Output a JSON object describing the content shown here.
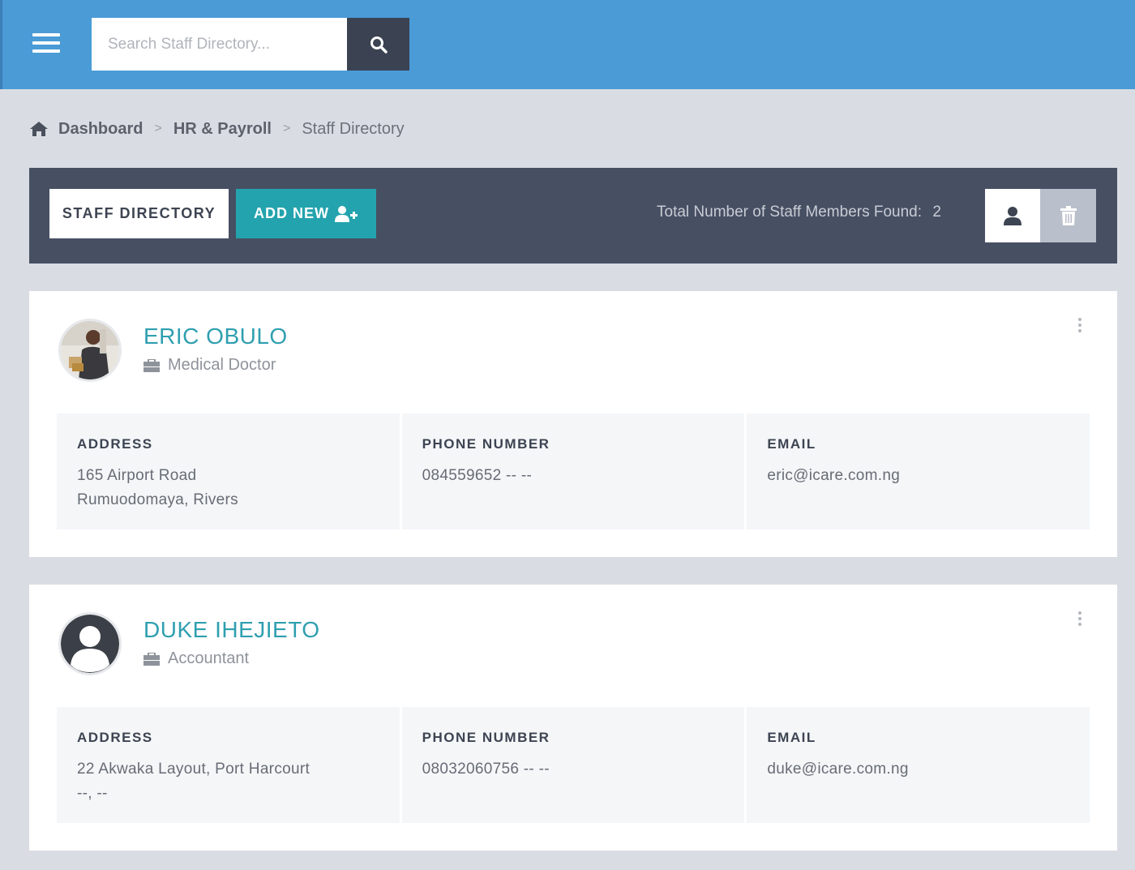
{
  "search": {
    "placeholder": "Search Staff Directory..."
  },
  "breadcrumb": {
    "items": [
      "Dashboard",
      "HR & Payroll",
      "Staff Directory"
    ]
  },
  "toolbar": {
    "directory_label": "STAFF DIRECTORY",
    "add_new_label": "ADD NEW",
    "total_label": "Total Number of Staff Members Found:",
    "total_count": "2"
  },
  "colors": {
    "topbar": "#4a9bd6",
    "toolbar": "#474f63",
    "accent": "#23a3ad",
    "name": "#2f9fb0"
  },
  "staff": [
    {
      "name": "ERIC OBULO",
      "role": "Medical Doctor",
      "avatar": "photo",
      "address_label": "ADDRESS",
      "address_line1": "165 Airport Road",
      "address_line2": "Rumuodomaya, Rivers",
      "phone_label": "PHONE NUMBER",
      "phone": "084559652 -- --",
      "email_label": "EMAIL",
      "email": "eric@icare.com.ng"
    },
    {
      "name": "DUKE IHEJIETO",
      "role": "Accountant",
      "avatar": "default-user-icon",
      "address_label": "ADDRESS",
      "address_line1": "22 Akwaka Layout, Port Harcourt",
      "address_line2": "--, --",
      "phone_label": "PHONE NUMBER",
      "phone": "08032060756 -- --",
      "email_label": "EMAIL",
      "email": "duke@icare.com.ng"
    }
  ]
}
